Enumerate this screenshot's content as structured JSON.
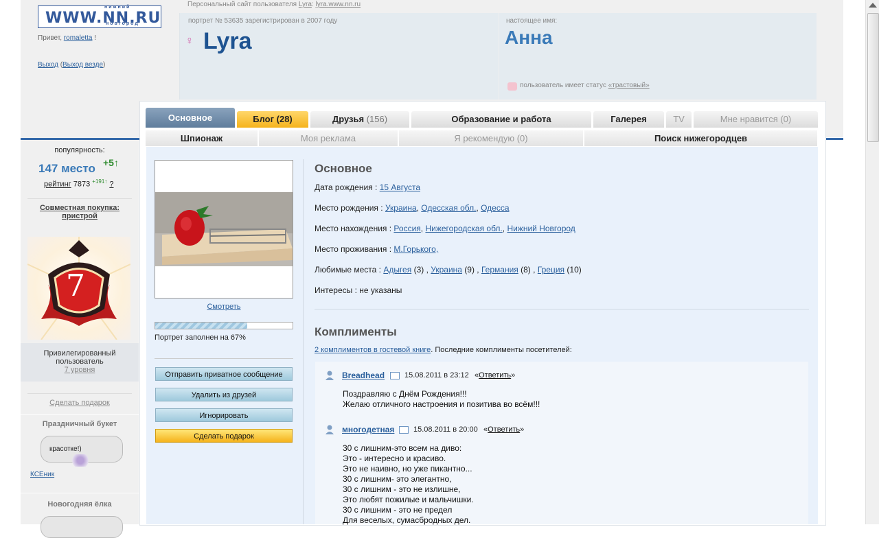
{
  "header": {
    "logo_top": "нижний",
    "logo_main": "WWW.NN.RU",
    "logo_bottom": "новгород",
    "greeting_prefix": "Привет,",
    "greeting_user": "romaletta",
    "greeting_suffix": "!",
    "logout": "Выход",
    "logout_everywhere": "Выход везде",
    "site_prefix": "Персональный сайт пользователя",
    "site_user": "Lyra",
    "site_url": "lyra.www.nn.ru"
  },
  "profile": {
    "portrait_info": "портрет № 53635 зарегистрирован в 2007 году",
    "username": "Lyra",
    "gender_symbol": "♀",
    "real_name_label": "настоящее имя:",
    "real_name": "Анна",
    "status_text": "пользователь имеет статус",
    "status_link": "«трастовый»"
  },
  "sidebar": {
    "popularity_label": "популярность:",
    "place": "147 место",
    "place_delta": "+5↑",
    "rating_label": "рейтинг",
    "rating_value": "7873",
    "rating_delta": "+191↑",
    "rating_help": "?",
    "joint_purchase": "Совместная покупка: пристрой",
    "badge_number": "7",
    "privileged_line1": "Привилегированный",
    "privileged_line2": "пользователь",
    "privileged_level": "7 уровня",
    "make_gift": "Сделать подарок",
    "gift1_title": "Праздничный букет",
    "gift1_bubble": "красотке!)",
    "gift1_from": "КСЕник",
    "gift2_title": "Новогодняя ёлка"
  },
  "tabs_row1": [
    {
      "label": "Основное",
      "count": ""
    },
    {
      "label": "Блог (28)",
      "count": ""
    },
    {
      "label": "Друзья",
      "count": "(156)"
    },
    {
      "label": "Образование и работа",
      "count": ""
    },
    {
      "label": "Галерея",
      "count": ""
    },
    {
      "label": "TV",
      "count": ""
    },
    {
      "label": "Мне нравится (0)",
      "count": ""
    }
  ],
  "tabs_row2": [
    {
      "label": "Шпионаж"
    },
    {
      "label": "Моя реклама"
    },
    {
      "label": "Я рекомендую (0)"
    },
    {
      "label": "Поиск нижегородцев"
    }
  ],
  "photo": {
    "view_link": "Смотреть",
    "progress": 0.67,
    "progress_text": "Портрет заполнен на 67%"
  },
  "actions": {
    "send_message": "Отправить приватное сообщение",
    "remove_friend": "Удалить из друзей",
    "ignore": "Игнорировать",
    "make_gift": "Сделать подарок"
  },
  "basics": {
    "title": "Основное",
    "birth_date_label": "Дата рождения :",
    "birth_date": "15 Августа",
    "birth_place_label": "Место рождения :",
    "birth_place": [
      "Украина",
      "Одесская обл.",
      "Одесса"
    ],
    "location_label": "Место нахождения :",
    "location": [
      "Россия",
      "Нижегородская обл.",
      "Нижний Новгород"
    ],
    "residence_label": "Место проживания :",
    "residence": "М.Горького,",
    "fav_places_label": "Любимые места :",
    "fav_places": [
      {
        "name": "Адыгея",
        "count": "(3)"
      },
      {
        "name": "Украина",
        "count": "(9)"
      },
      {
        "name": "Германия",
        "count": "(8)"
      },
      {
        "name": "Греция",
        "count": "(10)"
      }
    ],
    "interests_label": "Интересы :",
    "interests": "не указаны"
  },
  "compliments": {
    "title": "Комплименты",
    "guestbook_link": "2 комплиментов в гостевой книге",
    "guestbook_suffix": ". Последние комплименты посетителей:",
    "reply_label": "Ответить",
    "items": [
      {
        "author": "Breadhead",
        "date": "15.08.2011 в 23:12",
        "lines": [
          "Поздравляю с Днём Рождения!!!",
          "Желаю отличного настроения и позитива во всём!!!"
        ]
      },
      {
        "author": "многодетная",
        "date": "15.08.2011 в 20:00",
        "lines": [
          "30 с лишним-это всем на диво:",
          "Это - интересно и красиво.",
          "Это не наивно, но уже пикантно...",
          "30 с лишним- это элегантно,",
          "30 с лишним - это не излишне,",
          "Это любят пожилые и мальчишки.",
          "30 с лишним - это не предел",
          "Для веселых, сумасбродных дел."
        ]
      }
    ]
  }
}
